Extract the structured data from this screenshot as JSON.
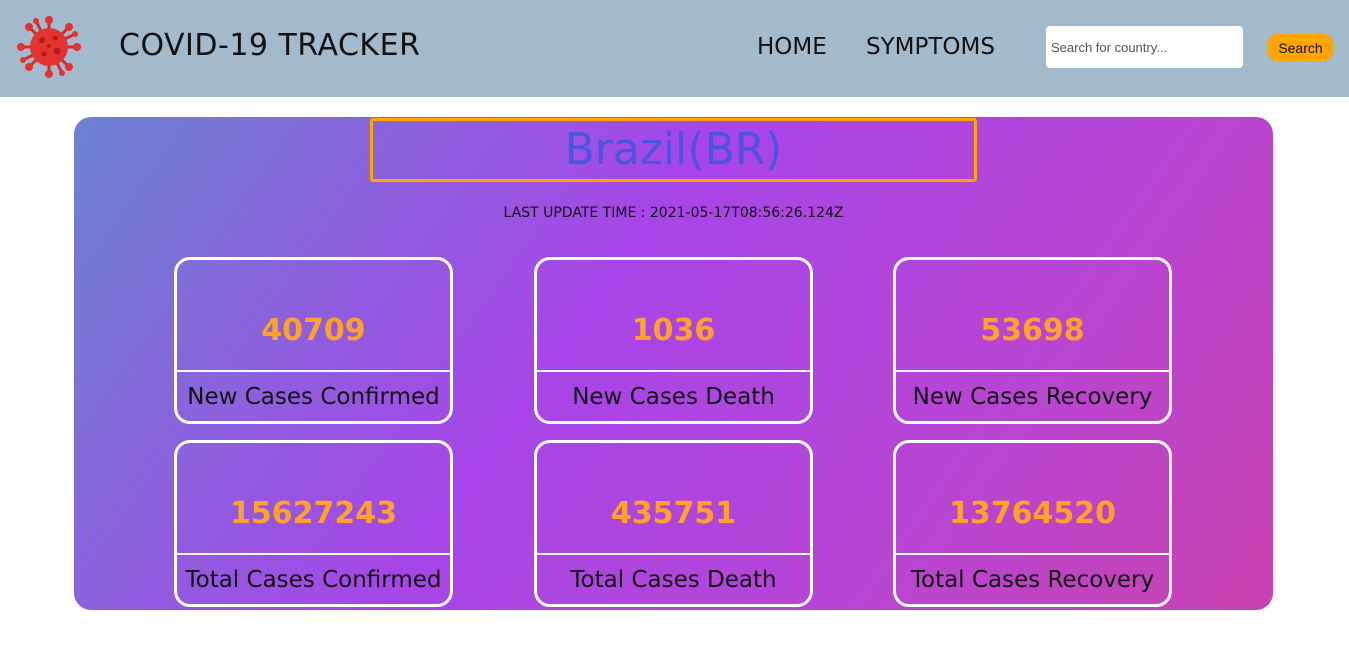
{
  "navbar": {
    "logo_icon": "coronavirus-icon",
    "brand": "COVID-19 TRACKER",
    "links": [
      "HOME",
      "SYMPTOMS"
    ],
    "search": {
      "placeholder": "Search for country...",
      "value": ""
    },
    "search_button": "Search"
  },
  "colors": {
    "navbar_bg": "#a3b9cc",
    "accent": "#ffa500",
    "country_text": "#4a55dd",
    "panel_gradient": [
      "#6b82d0",
      "#a745e8",
      "#c842b0"
    ]
  },
  "country": {
    "name": "Brazil(BR)",
    "last_update": "LAST UPDATE TIME : 2021-05-17T08:56:26.124Z"
  },
  "stats": [
    {
      "value": "40709",
      "label": "New Cases Confirmed"
    },
    {
      "value": "1036",
      "label": "New Cases Death"
    },
    {
      "value": "53698",
      "label": "New Cases Recovery"
    },
    {
      "value": "15627243",
      "label": "Total Cases Confirmed"
    },
    {
      "value": "435751",
      "label": "Total Cases Death"
    },
    {
      "value": "13764520",
      "label": "Total Cases Recovery"
    }
  ]
}
